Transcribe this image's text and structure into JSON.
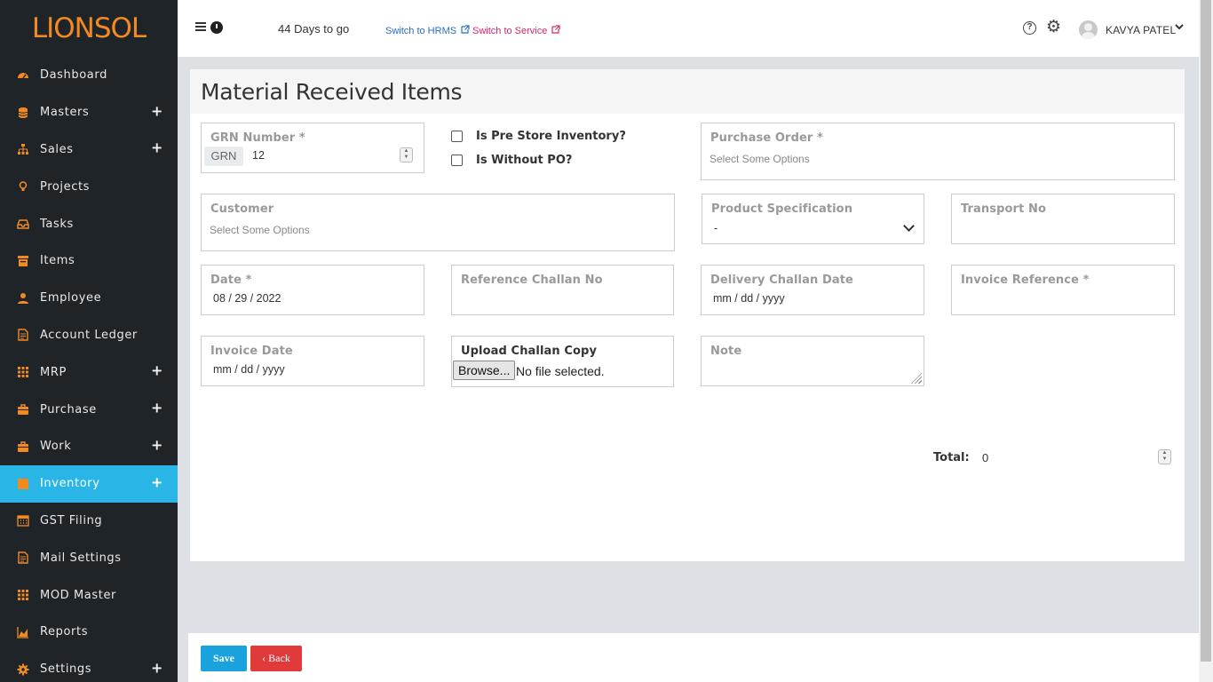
{
  "app": {
    "logo_text": "LIONSOL"
  },
  "sidebar": {
    "items": [
      {
        "label": "Dashboard",
        "icon": "speedometer-icon",
        "expandable": false,
        "active": false
      },
      {
        "label": "Masters",
        "icon": "database-icon",
        "expandable": true,
        "active": false
      },
      {
        "label": "Sales",
        "icon": "sitemap-icon",
        "expandable": true,
        "active": false
      },
      {
        "label": "Projects",
        "icon": "lightbulb-icon",
        "expandable": false,
        "active": false
      },
      {
        "label": "Tasks",
        "icon": "inbox-icon",
        "expandable": false,
        "active": false
      },
      {
        "label": "Items",
        "icon": "list-icon",
        "expandable": false,
        "active": false
      },
      {
        "label": "Employee",
        "icon": "user-icon",
        "expandable": false,
        "active": false
      },
      {
        "label": "Account Ledger",
        "icon": "document-icon",
        "expandable": false,
        "active": false
      },
      {
        "label": "MRP",
        "icon": "grid-icon",
        "expandable": true,
        "active": false
      },
      {
        "label": "Purchase",
        "icon": "briefcase-icon",
        "expandable": true,
        "active": false
      },
      {
        "label": "Work",
        "icon": "briefcase-icon",
        "expandable": true,
        "active": false
      },
      {
        "label": "Inventory",
        "icon": "box-icon",
        "expandable": true,
        "active": true
      },
      {
        "label": "GST Filing",
        "icon": "calendar-icon",
        "expandable": false,
        "active": false
      },
      {
        "label": "Mail Settings",
        "icon": "document-icon",
        "expandable": false,
        "active": false
      },
      {
        "label": "MOD Master",
        "icon": "grid-icon",
        "expandable": false,
        "active": false
      },
      {
        "label": "Reports",
        "icon": "area-chart-icon",
        "expandable": false,
        "active": false
      },
      {
        "label": "Settings",
        "icon": "gear-icon",
        "expandable": true,
        "active": false
      }
    ],
    "plus_symbol": "+"
  },
  "topbar": {
    "days_to_go": "44 Days to go",
    "switch_hrms": "Switch to HRMS",
    "switch_service": "Switch to Service",
    "help_symbol": "?",
    "user_name": "KAVYA PATEL"
  },
  "page": {
    "title": "Material Received Items"
  },
  "form": {
    "grn_number": {
      "label": "GRN Number *",
      "prefix": "GRN",
      "value": "12"
    },
    "is_pre_store": {
      "label": "Is Pre Store Inventory?",
      "checked": false
    },
    "is_without_po": {
      "label": "Is Without PO?",
      "checked": false
    },
    "purchase_order": {
      "label": "Purchase Order *",
      "placeholder": "Select Some Options"
    },
    "customer": {
      "label": "Customer",
      "placeholder": "Select Some Options"
    },
    "product_specification": {
      "label": "Product Specification",
      "value": "-"
    },
    "transport_no": {
      "label": "Transport No",
      "value": ""
    },
    "date": {
      "label": "Date *",
      "value": "08 / 29 / 2022"
    },
    "reference_challan_no": {
      "label": "Reference Challan No",
      "value": ""
    },
    "delivery_challan_date": {
      "label": "Delivery Challan Date",
      "value": "mm / dd / yyyy"
    },
    "invoice_reference": {
      "label": "Invoice Reference *",
      "value": ""
    },
    "invoice_date": {
      "label": "Invoice Date",
      "value": "mm / dd / yyyy"
    },
    "upload_challan": {
      "label": "Upload Challan Copy",
      "button": "Browse...",
      "status": "No file selected."
    },
    "note": {
      "label": "Note",
      "value": ""
    },
    "total": {
      "label": "Total:",
      "value": "0"
    }
  },
  "footer": {
    "save_label": "Save",
    "back_label": "Back"
  },
  "colors": {
    "sidebar_bg": "#1f2428",
    "accent_orange": "#f28a22",
    "active_blue": "#29b6e6",
    "save_blue": "#1aa2dc",
    "back_red": "#e03a3a"
  }
}
